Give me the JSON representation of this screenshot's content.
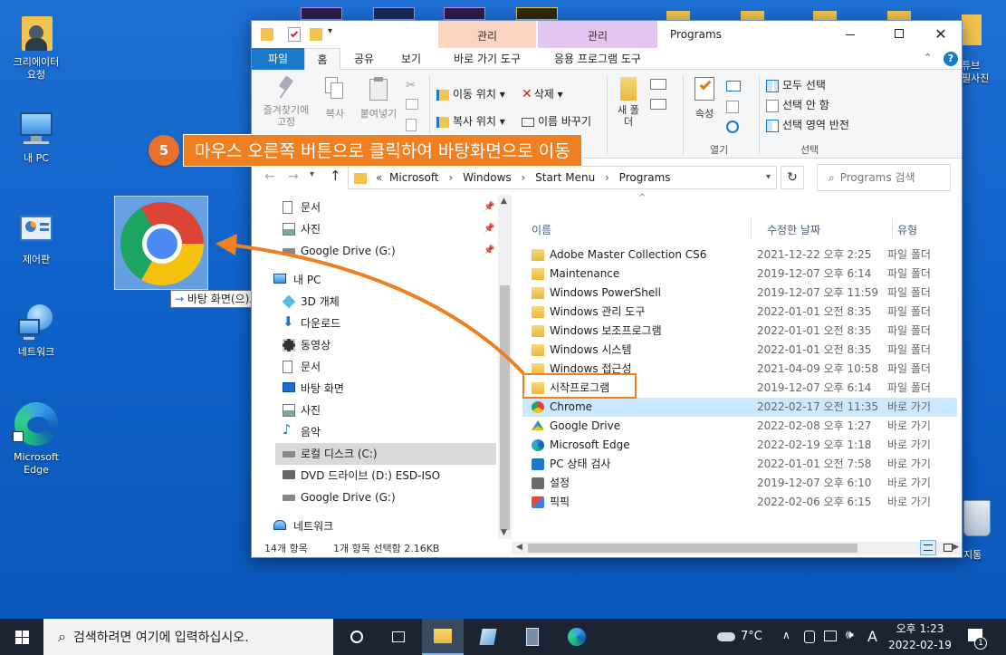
{
  "desktop": {
    "icons": [
      {
        "label": "크리에이터\n요청"
      },
      {
        "label": "내 PC"
      },
      {
        "label": "제어판"
      },
      {
        "label": "네트워크"
      },
      {
        "label": "Microsoft\nEdge"
      }
    ],
    "right_icons": [
      "튜브",
      "필사진",
      "지통"
    ]
  },
  "drag": {
    "tooltip_arrow": "→",
    "tooltip": "바탕 화면(으)로 이동"
  },
  "callout": {
    "number": "5",
    "text": "마우스 오른쪽 버튼으로 클릭하여 바탕화면으로 이동"
  },
  "window": {
    "title": "Programs",
    "context_tabs": [
      "관리",
      "관리"
    ],
    "tabs": [
      "파일",
      "홈",
      "공유",
      "보기",
      "바로 가기 도구",
      "응용 프로그램 도구"
    ],
    "ribbon": {
      "pin_label": "즐겨찾기에 고정",
      "copy": "복사",
      "paste": "붙여넣기",
      "move_to": "이동 위치 ▾",
      "copy_to": "복사 위치 ▾",
      "delete": "삭제 ▾",
      "rename": "이름 바꾸기",
      "new_folder": "새 폴더",
      "properties": "속성",
      "open_group": "열기",
      "select_all": "모두 선택",
      "select_none": "선택 안 함",
      "invert_selection": "선택 영역 반전",
      "select_group": "선택"
    },
    "address": {
      "prefix": "«",
      "crumbs": [
        "Microsoft",
        "Windows",
        "Start Menu",
        "Programs"
      ],
      "search_placeholder": "Programs 검색"
    },
    "nav": [
      {
        "label": "문서",
        "pinned": true
      },
      {
        "label": "사진",
        "pinned": true
      },
      {
        "label": "Google Drive (G:)",
        "pinned": true
      },
      {
        "label": "내 PC"
      },
      {
        "label": "3D 개체"
      },
      {
        "label": "다운로드"
      },
      {
        "label": "동영상"
      },
      {
        "label": "문서"
      },
      {
        "label": "바탕 화면"
      },
      {
        "label": "사진"
      },
      {
        "label": "음악"
      },
      {
        "label": "로컬 디스크 (C:)",
        "selected": true
      },
      {
        "label": "DVD 드라이브 (D:) ESD-ISO"
      },
      {
        "label": "Google Drive (G:)"
      },
      {
        "label": "네트워크"
      }
    ],
    "columns": [
      "이름",
      "수정한 날짜",
      "유형"
    ],
    "files": [
      {
        "name": "Adobe Master Collection CS6",
        "date": "2021-12-22 오후 2:25",
        "type": "파일 폴더",
        "icon": "folder-icon"
      },
      {
        "name": "Maintenance",
        "date": "2019-12-07 오후 6:14",
        "type": "파일 폴더",
        "icon": "folder-icon"
      },
      {
        "name": "Windows PowerShell",
        "date": "2019-12-07 오후 11:59",
        "type": "파일 폴더",
        "icon": "folder-icon"
      },
      {
        "name": "Windows 관리 도구",
        "date": "2022-01-01 오전 8:35",
        "type": "파일 폴더",
        "icon": "folder-icon"
      },
      {
        "name": "Windows 보조프로그램",
        "date": "2022-01-01 오전 8:35",
        "type": "파일 폴더",
        "icon": "folder-icon"
      },
      {
        "name": "Windows 시스템",
        "date": "2022-01-01 오전 8:35",
        "type": "파일 폴더",
        "icon": "folder-icon"
      },
      {
        "name": "Windows 접근성",
        "date": "2021-04-09 오후 10:58",
        "type": "파일 폴더",
        "icon": "folder-icon"
      },
      {
        "name": "시작프로그램",
        "date": "2019-12-07 오후 6:14",
        "type": "파일 폴더",
        "icon": "folder-icon"
      },
      {
        "name": "Chrome",
        "date": "2022-02-17 오전 11:35",
        "type": "바로 가기",
        "icon": "chrome-icon",
        "selected": true
      },
      {
        "name": "Google Drive",
        "date": "2022-02-08 오후 1:27",
        "type": "바로 가기",
        "icon": "google-drive-icon"
      },
      {
        "name": "Microsoft Edge",
        "date": "2022-02-19 오후 1:18",
        "type": "바로 가기",
        "icon": "edge-icon"
      },
      {
        "name": "PC 상태 검사",
        "date": "2022-01-01 오전 7:58",
        "type": "바로 가기",
        "icon": "pc-health-icon"
      },
      {
        "name": "설정",
        "date": "2019-12-07 오후 6:10",
        "type": "바로 가기",
        "icon": "settings-icon"
      },
      {
        "name": "픽픽",
        "date": "2022-02-06 오후 6:15",
        "type": "바로 가기",
        "icon": "picpick-icon"
      }
    ],
    "status": {
      "count": "14개 항목",
      "selection": "1개 항목 선택함 2.16KB"
    }
  },
  "taskbar": {
    "search_placeholder": "검색하려면 여기에 입력하십시오.",
    "weather": "7°C",
    "ime": "A",
    "time": "오후 1:23",
    "date": "2022-02-19",
    "notification_count": "1"
  },
  "colors": {
    "accent": "#0078d7",
    "callout_orange": "#f07f22",
    "selection": "#cce8ff",
    "context_tab_1": "#fbd5c1",
    "context_tab_2": "#e3c6f0"
  }
}
